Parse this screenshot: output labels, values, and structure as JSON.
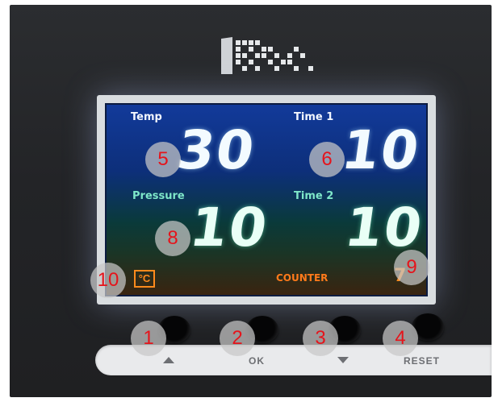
{
  "display": {
    "temp_label": "Temp",
    "temp_value": "30",
    "time1_label": "Time 1",
    "time1_value": "10",
    "pressure_label": "Pressure",
    "pressure_value": "10",
    "time2_label": "Time 2",
    "time2_value": "10",
    "unit": "°C",
    "counter_label": "COUNTER",
    "counter_value": "7"
  },
  "buttons": {
    "ok_label": "OK",
    "reset_label": "RESET"
  },
  "callouts": [
    "1",
    "2",
    "3",
    "4",
    "5",
    "6",
    "7",
    "8",
    "9",
    "10"
  ],
  "colors": {
    "callout_text": "#e5141b",
    "counter_text": "#ff8a1c",
    "label_green": "#7ee7c9"
  }
}
